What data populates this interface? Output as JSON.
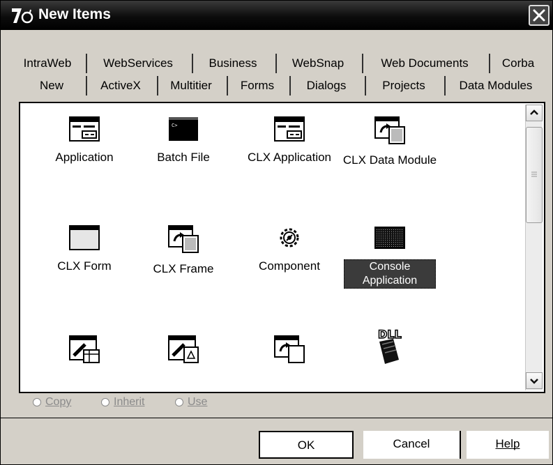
{
  "window": {
    "title": "New Items",
    "icon": "delphi-7-icon"
  },
  "tabs_back": [
    "IntraWeb",
    "WebServices",
    "Business",
    "WebSnap",
    "Web Documents",
    "Corba"
  ],
  "tabs_front": [
    "New",
    "ActiveX",
    "Multitier",
    "Forms",
    "Dialogs",
    "Projects",
    "Data Modules"
  ],
  "items": [
    {
      "label": "Application",
      "icon": "application-icon"
    },
    {
      "label": "Batch File",
      "icon": "batch-file-icon"
    },
    {
      "label": "CLX Application",
      "icon": "clx-application-icon"
    },
    {
      "label": "CLX Data Module",
      "icon": "clx-data-module-icon"
    },
    {
      "label": "CLX Form",
      "icon": "clx-form-icon"
    },
    {
      "label": "CLX Frame",
      "icon": "clx-frame-icon"
    },
    {
      "label": "Component",
      "icon": "component-gear-icon"
    },
    {
      "label": "Console Application",
      "icon": "console-application-icon",
      "selected": true
    },
    {
      "label": "",
      "icon": "control-panel-application-icon"
    },
    {
      "label": "",
      "icon": "control-panel-module-icon"
    },
    {
      "label": "",
      "icon": "data-module-icon"
    },
    {
      "label": "",
      "icon": "dll-wizard-icon"
    }
  ],
  "options": {
    "copy": "Copy",
    "inherit": "Inherit",
    "use": "Use"
  },
  "buttons": {
    "ok": "OK",
    "cancel": "Cancel",
    "help": "Help"
  },
  "colors": {
    "selection": "#3b3b3b",
    "titlebar": "#000000",
    "disabled_text": "#8a8a8a"
  }
}
